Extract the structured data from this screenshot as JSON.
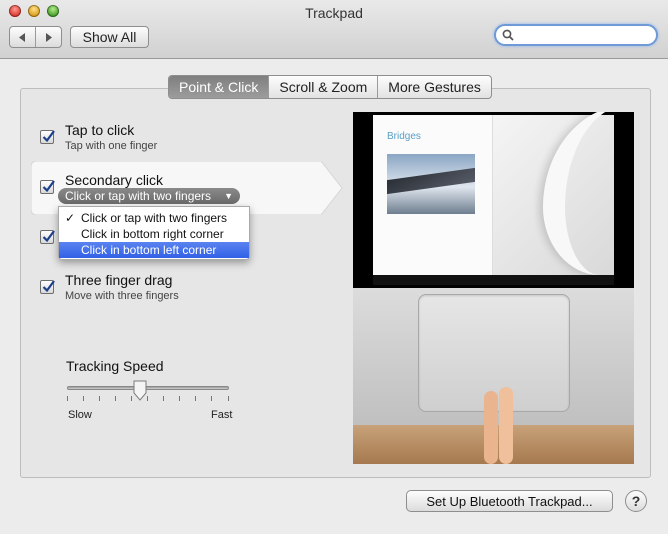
{
  "window": {
    "title": "Trackpad"
  },
  "toolbar": {
    "show_all": "Show All",
    "back_icon": "back-icon",
    "forward_icon": "forward-icon",
    "search_value": "",
    "search_placeholder": ""
  },
  "tabs": [
    {
      "label": "Point & Click",
      "active": true
    },
    {
      "label": "Scroll & Zoom",
      "active": false
    },
    {
      "label": "More Gestures",
      "active": false
    }
  ],
  "options": {
    "tap_to_click": {
      "title": "Tap to click",
      "subtitle": "Tap with one finger",
      "checked": true
    },
    "secondary_click": {
      "title": "Secondary click",
      "selected": "Click or tap with two fingers",
      "checked": true
    },
    "hidden_option": {
      "checked": true
    },
    "three_finger_drag": {
      "title": "Three finger drag",
      "subtitle": "Move with three fingers",
      "checked": true
    }
  },
  "secondary_menu": {
    "items": [
      {
        "label": "Click or tap with two fingers",
        "checked": true,
        "highlighted": false
      },
      {
        "label": "Click in bottom right corner",
        "checked": false,
        "highlighted": false
      },
      {
        "label": "Click in bottom left corner",
        "checked": false,
        "highlighted": true
      }
    ],
    "check_mark": "✓"
  },
  "tracking": {
    "title": "Tracking Speed",
    "min_label": "Slow",
    "max_label": "Fast",
    "level": 0.45
  },
  "preview": {
    "book_title": "Bridges"
  },
  "footer": {
    "bluetooth_button": "Set Up Bluetooth Trackpad...",
    "help": "?"
  },
  "colors": {
    "selection": "#3261e6",
    "active_tab": "#8a8a8a",
    "focus_ring": "#6f9ad6"
  }
}
